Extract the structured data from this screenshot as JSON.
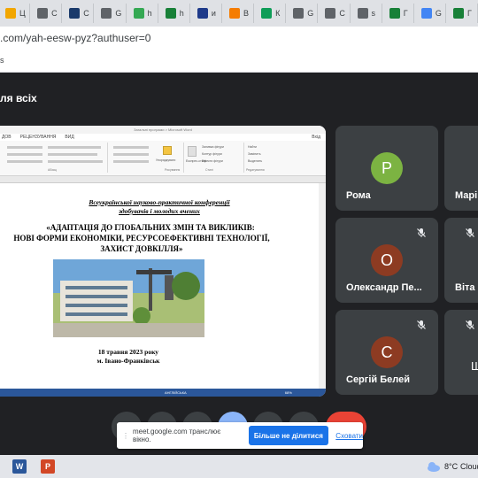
{
  "tabs": [
    {
      "label": "Ц",
      "color": "#f2a600"
    },
    {
      "label": "C",
      "color": "#5f6368"
    },
    {
      "label": "C",
      "color": "#1a3a6b"
    },
    {
      "label": "G",
      "color": "#5f6368"
    },
    {
      "label": "h",
      "color": "#34a853"
    },
    {
      "label": "h",
      "color": "#188038"
    },
    {
      "label": "и",
      "color": "#1e3a8a"
    },
    {
      "label": "B",
      "color": "#f57c00"
    },
    {
      "label": "К",
      "color": "#0f9d58"
    },
    {
      "label": "G",
      "color": "#5f6368"
    },
    {
      "label": "C",
      "color": "#5f6368"
    },
    {
      "label": "s",
      "color": "#5f6368"
    },
    {
      "label": "Г",
      "color": "#188038"
    },
    {
      "label": "G",
      "color": "#4285f4"
    },
    {
      "label": "Г",
      "color": "#188038"
    }
  ],
  "address": {
    "url": ".com/yah-eesw-pyz?authuser=0"
  },
  "bookmarks": {
    "label": "s"
  },
  "meet": {
    "heading": "ля всіх"
  },
  "word": {
    "title_bar": "Загальні програми > Microsoft Word",
    "tabs": [
      "ДОВ",
      "РЕЦЕНЗУВАННЯ",
      "ВИД"
    ],
    "login": "Вхід",
    "ribbon_groups": [
      "Абзац",
      "Рисування",
      "Стилі",
      "Редагування"
    ],
    "ribbon_items": [
      "Упорядкувати",
      "Експрес-стилі",
      "Заливка фігури",
      "Контур фігури",
      "Ефекти фігури",
      "Найти",
      "Замінить",
      "Выделить"
    ],
    "doc": {
      "line1": "Всеукраїнської науково-практичної конференції",
      "line2": "здобувачів і молодих вчених",
      "title1": "«АДАПТАЦІЯ ДО ГЛОБАЛЬНИХ ЗМІН ТА ВИКЛИКІВ:",
      "title2": "НОВІ ФОРМИ ЕКОНОМІКИ, РЕСУРСОЕФЕКТИВНІ ТЕХНОЛОГІЇ,",
      "title3": "ЗАХИСТ ДОВКІЛЛЯ»",
      "date": "18 травня 2023 року",
      "city": "м. Івано-Франківськ"
    },
    "status_lang": "АНГЛІЙСЬКА",
    "zoom": "68%"
  },
  "participants": [
    {
      "name": "Рома",
      "initial": "P",
      "color": "#7cb342",
      "muted": false
    },
    {
      "name": "Марі",
      "initial": "",
      "color": "",
      "muted": false
    },
    {
      "name": "Олександр Пе...",
      "initial": "О",
      "color": "#8d3b22",
      "muted": true
    },
    {
      "name": "Віта",
      "initial": "",
      "color": "",
      "muted": true
    },
    {
      "name": "Сергій Белей",
      "initial": "С",
      "color": "#8d3b22",
      "muted": true
    },
    {
      "name": "Ш",
      "initial": "",
      "color": "",
      "muted": true
    }
  ],
  "sharebar": {
    "message": "meet.google.com транслює вікно.",
    "stop_label": "Більше не ділитися",
    "hide_label": "Сховати"
  },
  "taskbar": {
    "word_label": "W",
    "ppt_label": "P",
    "weather_temp": "8°C",
    "weather_text": "Cloud"
  }
}
